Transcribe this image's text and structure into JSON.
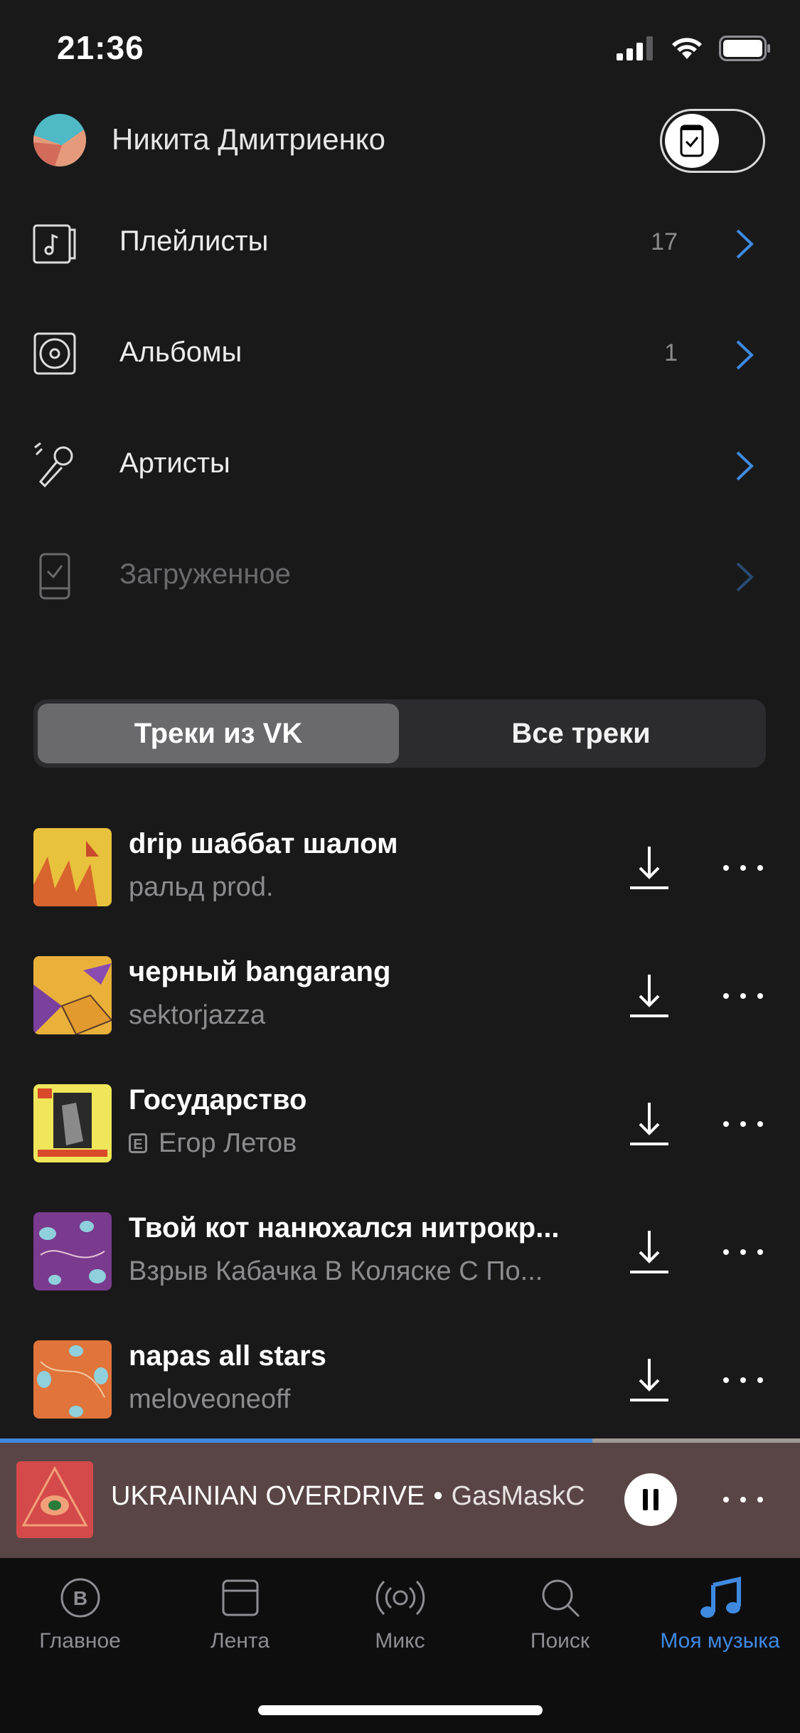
{
  "status_bar": {
    "time": "21:36"
  },
  "account": {
    "name": "Никита Дмитриенко"
  },
  "menu": [
    {
      "label": "Плейлисты",
      "count": "17",
      "icon": "music-note-icon"
    },
    {
      "label": "Альбомы",
      "count": "1",
      "icon": "vinyl-icon"
    },
    {
      "label": "Артисты",
      "count": "",
      "icon": "microphone-icon"
    },
    {
      "label": "Загруженное",
      "count": "",
      "icon": "downloaded-phone-icon"
    }
  ],
  "segmented": {
    "active": "Треки из VK",
    "inactive": "Все треки"
  },
  "tracks": [
    {
      "title": "drip шаббат шалом",
      "artist": "ральд prod.",
      "explicit": false
    },
    {
      "title": "черный bangarang",
      "artist": "sektorjazza",
      "explicit": false
    },
    {
      "title": "Государство",
      "artist": "Егор Летов",
      "explicit": true
    },
    {
      "title": "Твой кот нанюхался нитрокр...",
      "artist": "Взрыв Кабачка В Коляске С По...",
      "explicit": false
    },
    {
      "title": "napas all stars",
      "artist": "meloveoneoff",
      "explicit": false
    }
  ],
  "explicit_badge": "E",
  "now_playing": {
    "title": "UKRAINIAN OVERDRIVE",
    "separator": "•",
    "artist": "GasMaskC",
    "progress": 0.74
  },
  "tabs": [
    {
      "label": "Главное",
      "icon": "vk-logo-icon",
      "active": false
    },
    {
      "label": "Лента",
      "icon": "feed-icon",
      "active": false
    },
    {
      "label": "Микс",
      "icon": "radio-icon",
      "active": false
    },
    {
      "label": "Поиск",
      "icon": "search-icon",
      "active": false
    },
    {
      "label": "Моя музыка",
      "icon": "music-icon",
      "active": true
    }
  ],
  "colors": {
    "accent": "#3f8ae0",
    "background": "#19191a",
    "mini_player": "#5a4546"
  }
}
